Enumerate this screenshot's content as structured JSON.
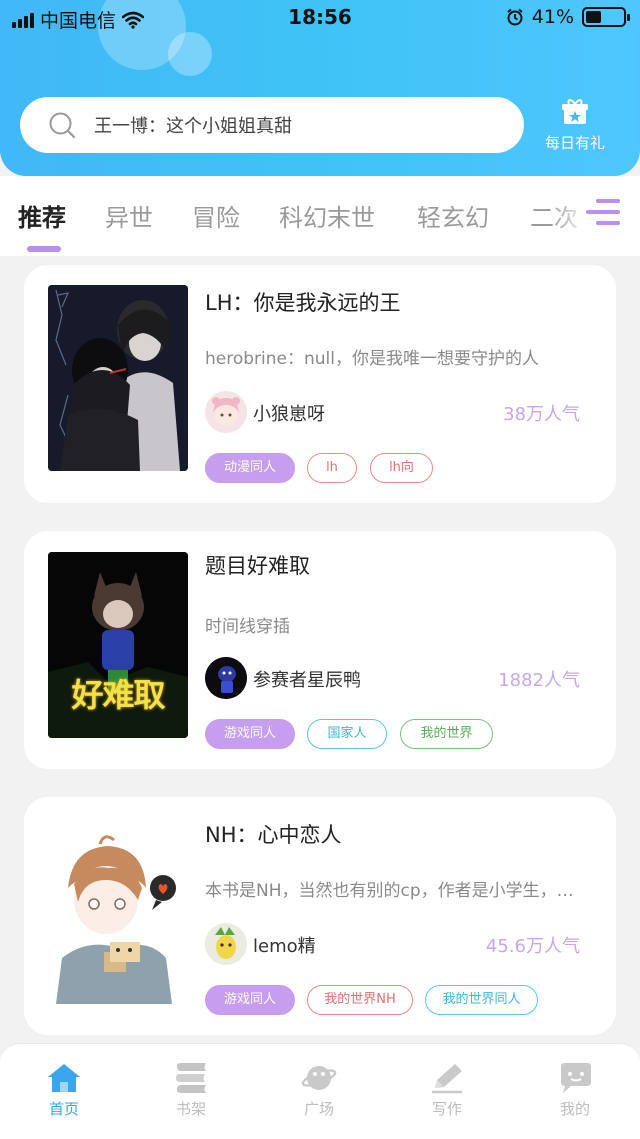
{
  "status_bar": {
    "carrier": "中国电信",
    "time": "18:56",
    "battery": "41%",
    "battery_level": 0.41
  },
  "search": {
    "placeholder": "王一博：这个小姐姐真甜"
  },
  "gift": {
    "label": "每日有礼"
  },
  "tabs": [
    {
      "label": "推荐",
      "active": true
    },
    {
      "label": "异世"
    },
    {
      "label": "冒险"
    },
    {
      "label": "科幻末世"
    },
    {
      "label": "轻玄幻"
    },
    {
      "label": "二次"
    }
  ],
  "books": [
    {
      "title": "LH：你是我永远的王",
      "desc": "herobrine：null，你是我唯一想要守护的人",
      "author": "小狼崽呀",
      "popularity": "38万人气",
      "tags": [
        {
          "label": "动漫同人",
          "style": "fill"
        },
        {
          "label": "lh",
          "style": "red"
        },
        {
          "label": "lh向",
          "style": "red"
        }
      ]
    },
    {
      "title": "题目好难取",
      "desc": "时间线穿插",
      "author": "参赛者星辰鸭",
      "popularity": "1882人气",
      "cover_text": "好难取",
      "tags": [
        {
          "label": "游戏同人",
          "style": "fill"
        },
        {
          "label": "国家人",
          "style": "cyan"
        },
        {
          "label": "我的世界",
          "style": "green"
        }
      ]
    },
    {
      "title": "NH：心中恋人",
      "desc": "本书是NH，当然也有别的cp，作者是小学生，喜欢的可以点个关注",
      "author": "lemo精",
      "popularity": "45.6万人气",
      "tags": [
        {
          "label": "游戏同人",
          "style": "fill"
        },
        {
          "label": "我的世界NH",
          "style": "red"
        },
        {
          "label": "我的世界同人",
          "style": "cyan"
        }
      ]
    }
  ],
  "bottom_nav": [
    {
      "label": "首页",
      "icon": "home-icon",
      "active": true
    },
    {
      "label": "书架",
      "icon": "bookshelf-icon"
    },
    {
      "label": "广场",
      "icon": "planet-icon"
    },
    {
      "label": "写作",
      "icon": "pen-icon"
    },
    {
      "label": "我的",
      "icon": "chat-bubble-icon"
    }
  ],
  "colors": {
    "header": "#41b8f7",
    "accent_purple": "#c79df0",
    "nav_active": "#3aa6f0"
  }
}
